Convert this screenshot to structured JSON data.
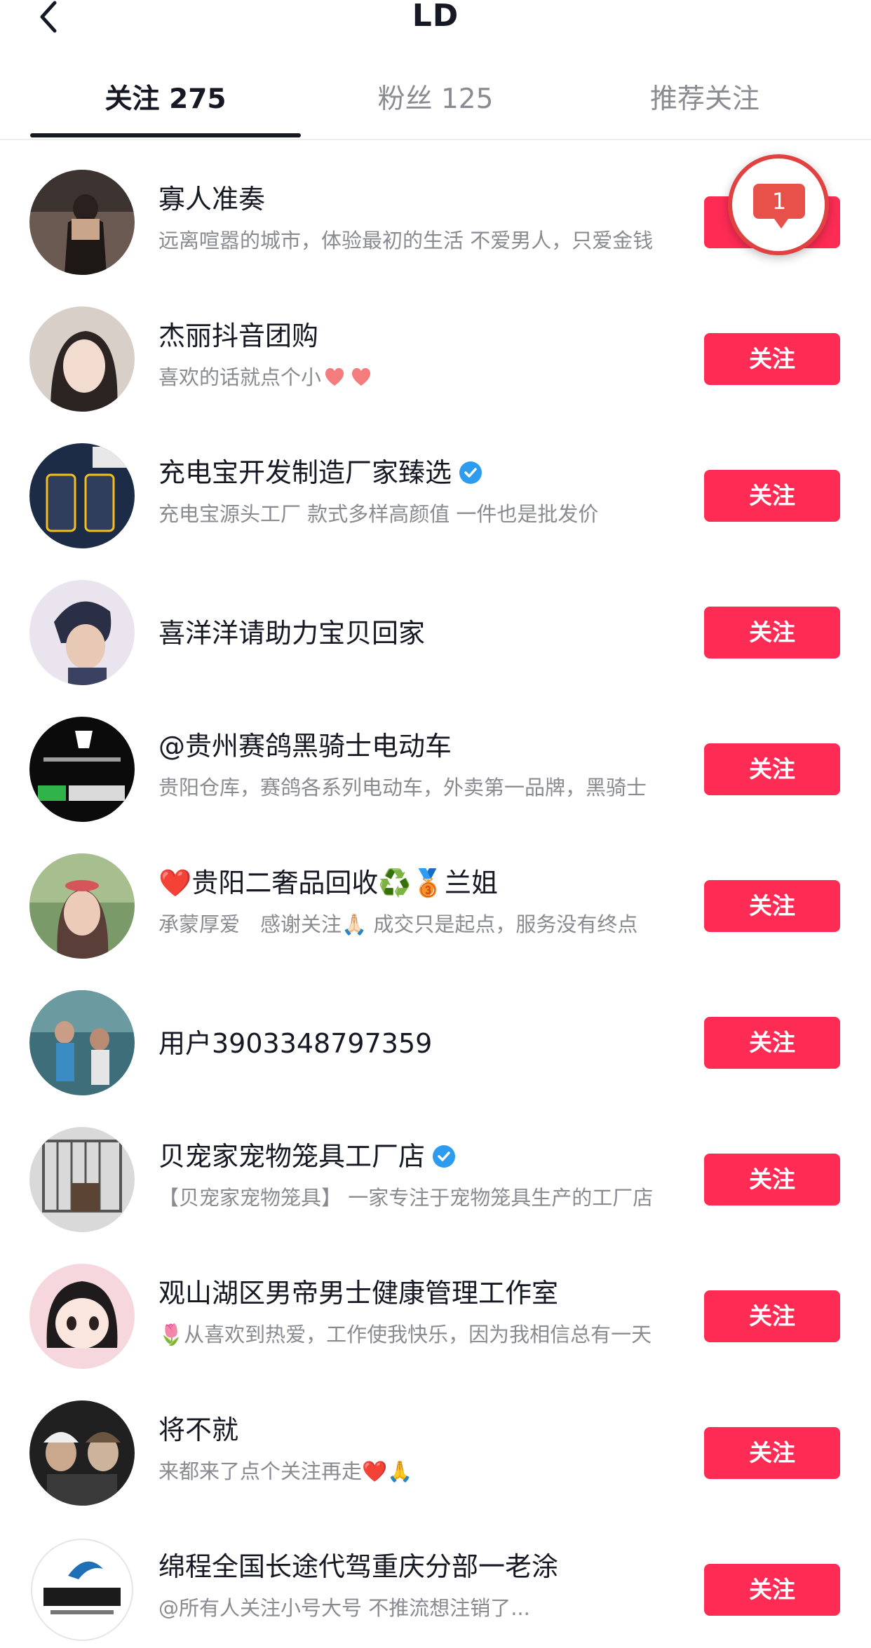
{
  "header": {
    "title": "LD"
  },
  "tabs": [
    {
      "label": "关注 275"
    },
    {
      "label": "粉丝 125"
    },
    {
      "label": "推荐关注"
    }
  ],
  "notification": {
    "count": "1"
  },
  "users": [
    {
      "name": "寡人准奏",
      "desc": "远离喧嚣的城市，体验最初的生活 不爱男人，只爱金钱",
      "button": "关注",
      "verified": false
    },
    {
      "name": "杰丽抖音团购",
      "desc": "喜欢的话就点个小",
      "button": "关注",
      "verified": false
    },
    {
      "name": "充电宝开发制造厂家臻选",
      "desc": "充电宝源头工厂 款式多样高颜值 一件也是批发价",
      "button": "关注",
      "verified": true
    },
    {
      "name": "喜洋洋请助力宝贝回家",
      "desc": "",
      "button": "关注",
      "verified": false
    },
    {
      "name": "@贵州赛鸽黑骑士电动车",
      "desc": "贵阳仓库，赛鸽各系列电动车，外卖第一品牌，黑骑士",
      "button": "关注",
      "verified": false
    },
    {
      "name": "❤️贵阳二奢品回收♻️🥉兰姐",
      "desc": "承蒙厚爱　感谢关注🙏🏻 成交只是起点，服务没有终点",
      "button": "关注",
      "verified": false
    },
    {
      "name": "用户3903348797359",
      "desc": "",
      "button": "关注",
      "verified": false
    },
    {
      "name": "贝宠家宠物笼具工厂店",
      "desc": "【贝宠家宠物笼具】 一家专注于宠物笼具生产的工厂店",
      "button": "关注",
      "verified": true
    },
    {
      "name": "观山湖区男帝男士健康管理工作室",
      "desc": "🌷从喜欢到热爱，工作使我快乐，因为我相信总有一天",
      "button": "关注",
      "verified": false
    },
    {
      "name": "将不就",
      "desc": "来都来了点个关注再走❤️🙏",
      "button": "关注",
      "verified": false
    },
    {
      "name": "绵程全国长途代驾重庆分部一老涂",
      "desc": "@所有人关注小号大号  不推流想注销了...",
      "button": "关注",
      "verified": false
    }
  ]
}
